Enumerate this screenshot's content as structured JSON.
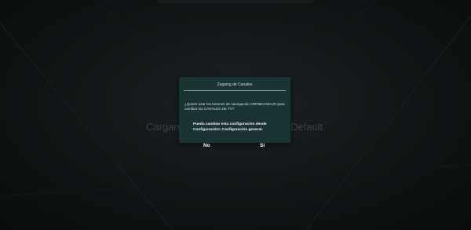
{
  "background": {
    "left_text": "Cargan",
    "right_text": "Default"
  },
  "dialog": {
    "title": "Zapping de Canales",
    "question": "¿Quiere usar los botones de navegación ARRIBA/ABAJO para cambiar los CANALES DE TV?",
    "note": "Puedo cambiar esta configuración desde Configuración> Configuración general.",
    "buttons": {
      "no_label": "No",
      "yes_label": "Si"
    }
  },
  "colors": {
    "dialog_bg": "#1a3433",
    "screen_bg": "#0c0f10"
  }
}
